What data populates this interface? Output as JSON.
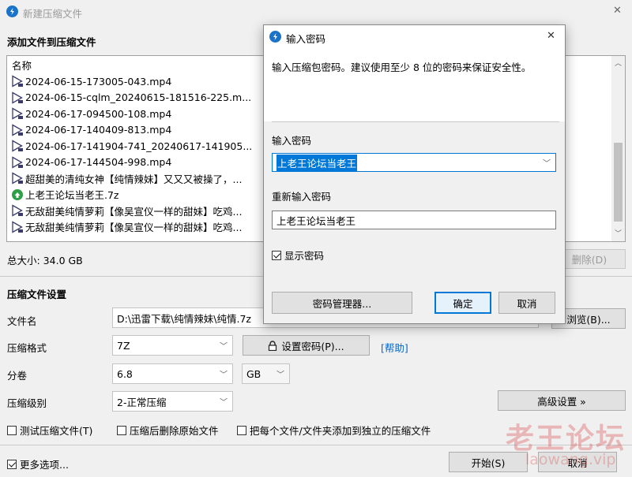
{
  "window": {
    "title": "新建压缩文件",
    "close": "✕"
  },
  "add_section": {
    "title": "添加文件到压缩文件",
    "column_name": "名称"
  },
  "files": [
    {
      "name": "2024-06-15-173005-043.mp4",
      "type": "video"
    },
    {
      "name": "2024-06-15-cqlm_20240615-181516-225.m...",
      "type": "video"
    },
    {
      "name": "2024-06-17-094500-108.mp4",
      "type": "video"
    },
    {
      "name": "2024-06-17-140409-813.mp4",
      "type": "video"
    },
    {
      "name": "2024-06-17-141904-741_20240617-141905...",
      "type": "video"
    },
    {
      "name": "2024-06-17-144504-998.mp4",
      "type": "video"
    },
    {
      "name": "超甜美的清纯女神【纯情辣妹】又又又被操了，...",
      "type": "video"
    },
    {
      "name": "上老王论坛当老王.7z",
      "type": "archive"
    },
    {
      "name": "无敌甜美纯情萝莉【像吴宣仪一样的甜妹】吃鸡...",
      "type": "video"
    },
    {
      "name": "无敌甜美纯情萝莉【像吴宣仪一样的甜妹】吃鸡...",
      "type": "video"
    }
  ],
  "total_size": "总大小: 34.0 GB",
  "delete_button": "删除(D)",
  "settings": {
    "title": "压缩文件设置",
    "filename_label": "文件名",
    "filename_value": "D:\\迅雷下载\\纯情辣妹\\纯情.7z",
    "browse_button": "浏览(B)...",
    "format_label": "压缩格式",
    "format_value": "7Z",
    "set_password_button": "设置密码(P)...",
    "help_link": "[帮助]",
    "volume_label": "分卷",
    "volume_value": "6.8",
    "volume_unit": "GB",
    "level_label": "压缩级别",
    "level_value": "2-正常压缩",
    "advanced_button": "高级设置 »",
    "opt_test": "测试压缩文件(T)",
    "opt_delete": "压缩后删除原始文件",
    "opt_each": "把每个文件/文件夹添加到独立的压缩文件"
  },
  "footer": {
    "more_options": "更多选项...",
    "start_button": "开始(S)",
    "cancel_button": "取消"
  },
  "dialog": {
    "title": "输入密码",
    "close": "✕",
    "description": "输入压缩包密码。建议使用至少 8 位的密码来保证安全性。",
    "password_label": "输入密码",
    "password_value": "上老王论坛当老王",
    "confirm_label": "重新输入密码",
    "confirm_value": "上老王论坛当老王",
    "show_password": "显示密码",
    "manager_button": "密码管理器...",
    "ok_button": "确定",
    "cancel_button": "取消"
  },
  "watermark": {
    "text": "老王论坛",
    "url": "laowang.vip"
  },
  "colors": {
    "accent": "#0078d7",
    "link": "#0066cc",
    "selection": "#0078d7",
    "watermark": "#d73c3c"
  }
}
